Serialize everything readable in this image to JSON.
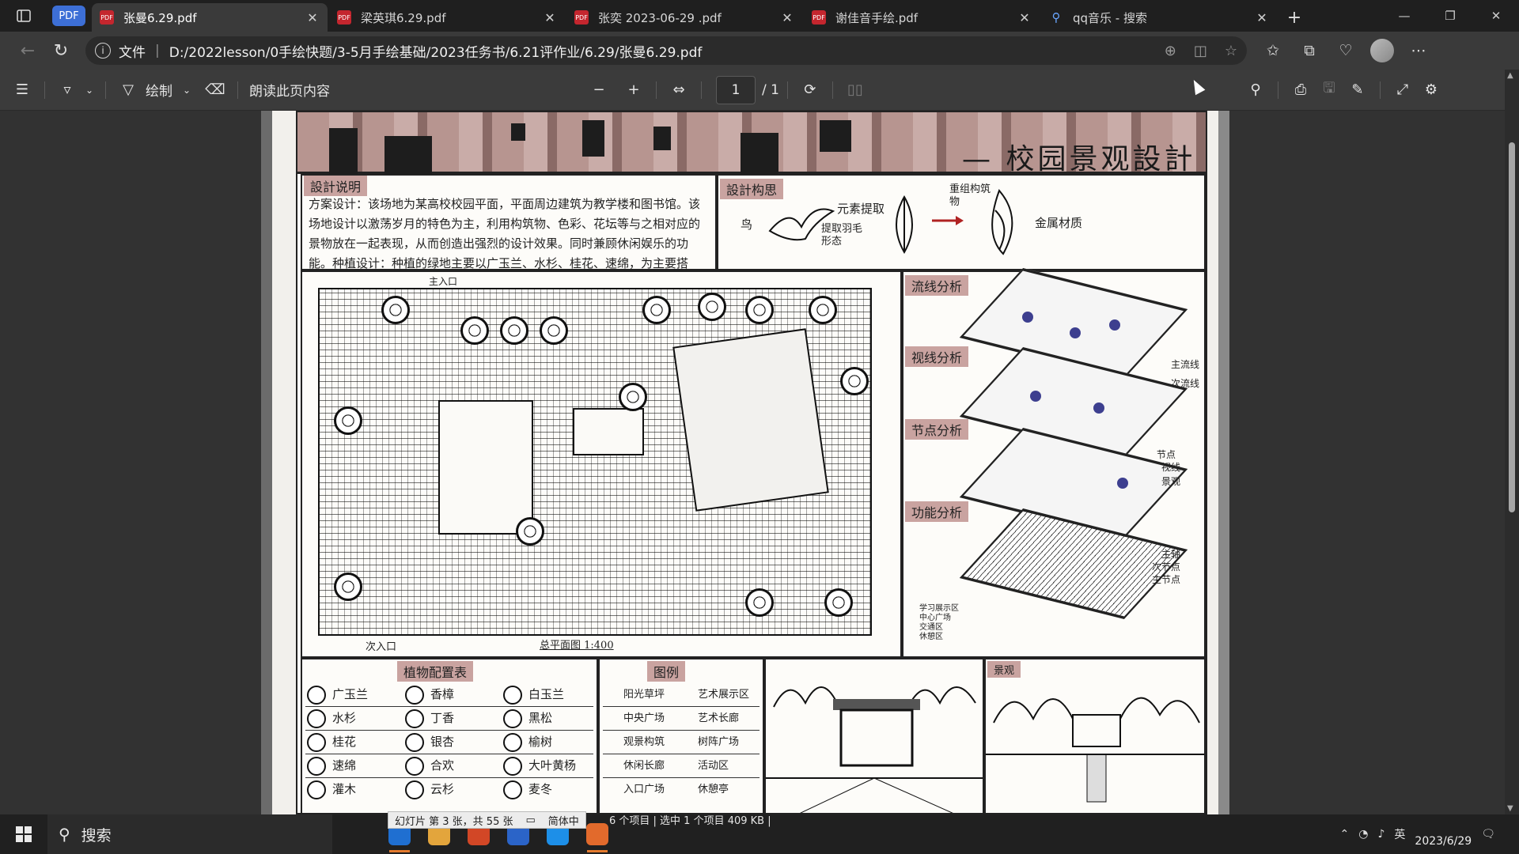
{
  "browser": {
    "tabs": [
      {
        "title": "张曼6.29.pdf",
        "icon": "pdf-icon",
        "active": true
      },
      {
        "title": "梁英琪6.29.pdf",
        "icon": "pdf-icon",
        "active": false
      },
      {
        "title": "张奕 2023-06-29 .pdf",
        "icon": "pdf-icon",
        "active": false
      },
      {
        "title": "谢佳音手绘.pdf",
        "icon": "pdf-icon",
        "active": false
      },
      {
        "title": "qq音乐 - 搜索",
        "icon": "search-icon",
        "active": false
      }
    ],
    "badge_label": "PDF",
    "address": {
      "scheme_label": "文件",
      "url": "D:/2022lesson/0手绘快题/3-5月手绘基础/2023任务书/6.21评作业/6.29/张曼6.29.pdf"
    }
  },
  "pdf_toolbar": {
    "draw_label": "绘制",
    "read_aloud_label": "朗读此页内容",
    "page_current": "1",
    "page_total": "/ 1"
  },
  "document": {
    "title_line": "— 校园景观設計",
    "labels": {
      "design_notes": "設計说明",
      "concept": "設計构思",
      "flow_analysis": "流线分析",
      "view_analysis": "视线分析",
      "node_analysis": "节点分析",
      "function_analysis": "功能分析",
      "plant_table": "植物配置表",
      "legend": "图例",
      "plan_caption": "总平面图 1:400",
      "secondary_entrance": "次入口",
      "main_entrance": "主入口",
      "elevation": "景观"
    },
    "notes_text": "方案设计：该场地为某高校校园平面，平面周边建筑为教学楼和图书馆。该场地设计以激荡岁月的特色为主，利用构筑物、色彩、花坛等与之相对应的景物放在一起表现，从而创造出强烈的设计效果。同时兼顾休闲娱乐的功能。种植设计：种植的绿地主要以广玉兰、水杉、桂花、速绵，为主要搭配，以及些许灌木及草为次要搭配，丰富空间层次，营造绿色健康的校园生态环境。",
    "concept_text": [
      "鸟",
      "元素提取",
      "提取羽毛形态",
      "重组构筑物",
      "金属材质"
    ],
    "analysis_notes": [
      "主流线",
      "次流线",
      "节点",
      "视线",
      "景观",
      "主轴",
      "次节点",
      "主节点"
    ],
    "plant_rows": [
      [
        "广玉兰",
        "香樟",
        "白玉兰"
      ],
      [
        "水杉",
        "丁香",
        "黑松"
      ],
      [
        "桂花",
        "银杏",
        "榆树"
      ],
      [
        "速绵",
        "合欢",
        "大叶黄杨"
      ],
      [
        "灌木",
        "云杉",
        "麦冬"
      ]
    ],
    "legend_rows": [
      [
        "阳光草坪",
        "艺术展示区"
      ],
      [
        "中央广场",
        "艺术长廊"
      ],
      [
        "观景构筑",
        "树阵广场"
      ],
      [
        "休闲长廊",
        "活动区"
      ],
      [
        "入口广场",
        "休憩亭"
      ]
    ],
    "function_legend": [
      "学习展示区",
      "中心广场",
      "交通区",
      "休憩区"
    ]
  },
  "taskbar": {
    "search_label": "搜索",
    "ppt_status": "幻灯片 第 3 张，共 55 张",
    "ime_label": "简体中",
    "explorer_status": "6 个项目  |  选中 1 个项目  409 KB  |",
    "date": "2023/6/29",
    "app_colors": [
      "#1f6fd1",
      "#e3a53c",
      "#d24726",
      "#2b64c8",
      "#1d8fe8",
      "#e26a2c"
    ]
  }
}
